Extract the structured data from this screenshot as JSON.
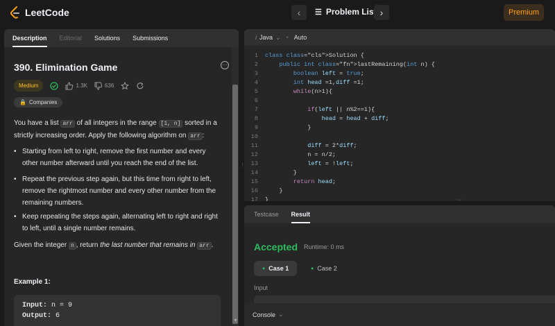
{
  "header": {
    "logo_text": "LeetCode",
    "problem_list_label": "Problem List",
    "premium_label": "Premium",
    "prev_icon": "chevron-left-icon",
    "next_icon": "chevron-right-icon"
  },
  "left_tabs": [
    {
      "label": "Description"
    },
    {
      "label": "Editorial"
    },
    {
      "label": "Solutions"
    },
    {
      "label": "Submissions"
    }
  ],
  "problem": {
    "title": "390. Elimination Game",
    "difficulty": "Medium",
    "likes": "1.3K",
    "dislikes": "636",
    "companies_label": "Companies",
    "desc_1a": "You have a list ",
    "desc_1_code1": "arr",
    "desc_1b": " of all integers in the range ",
    "desc_1_code2": "[1, n]",
    "desc_1c": " sorted in a strictly increasing order. Apply the following algorithm on ",
    "desc_1_code3": "arr",
    "desc_1d": ":",
    "bullet_1": "Starting from left to right, remove the first number and every other number afterward until you reach the end of the list.",
    "bullet_2": "Repeat the previous step again, but this time from right to left, remove the rightmost number and every other number from the remaining numbers.",
    "bullet_3": "Keep repeating the steps again, alternating left to right and right to left, until a single number remains.",
    "given_a": "Given the integer ",
    "given_code1": "n",
    "given_b": ", return ",
    "given_em": "the last number that remains in ",
    "given_code2": "arr",
    "given_c": ".",
    "example_title": "Example 1:",
    "example_input_label": "Input:",
    "example_input_value": " n = 9",
    "example_output_label": "Output:",
    "example_output_value": " 6"
  },
  "editor": {
    "language": "Java",
    "mode": "Auto",
    "lines": [
      "class Solution {",
      "    public int lastRemaining(int n) {",
      "        boolean left = true;",
      "        int head =1,diff =1;",
      "        while(n>1){",
      "",
      "            if(left || n%2==1){",
      "                head = head + diff;",
      "            }",
      "",
      "            diff = 2*diff;",
      "            n = n/2;",
      "            left = !left;",
      "        }",
      "        return head;",
      "    }",
      "}"
    ]
  },
  "result": {
    "tabs": [
      {
        "label": "Testcase"
      },
      {
        "label": "Result"
      }
    ],
    "status": "Accepted",
    "runtime": "Runtime: 0 ms",
    "case1": "Case 1",
    "case2": "Case 2",
    "input_label": "Input",
    "console_label": "Console"
  },
  "colors": {
    "accent_orange": "#ffa116",
    "accepted_green": "#2cbb5d",
    "medium_yellow": "#ffc01e"
  }
}
